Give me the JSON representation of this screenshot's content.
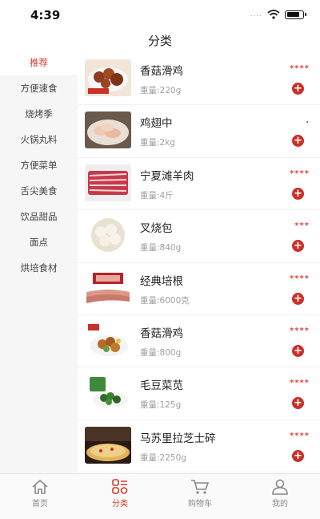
{
  "status": {
    "time": "4:39",
    "signal": "....",
    "battery_level": 0.8
  },
  "header": {
    "title": "分类"
  },
  "sidebar": {
    "items": [
      {
        "label": "推荐"
      },
      {
        "label": "方便速食"
      },
      {
        "label": "烧烤季"
      },
      {
        "label": "火锅丸料"
      },
      {
        "label": "方便菜单"
      },
      {
        "label": "舌尖美食"
      },
      {
        "label": "饮品甜品"
      },
      {
        "label": "面点"
      },
      {
        "label": "烘培食材"
      }
    ]
  },
  "products": [
    {
      "name": "香菇滑鸡",
      "weight": "重量:220g",
      "price": "****",
      "add": "+"
    },
    {
      "name": "鸡翅中",
      "weight": "重量:2kg",
      "price": ".",
      "add": "+"
    },
    {
      "name": "宁夏滩羊肉",
      "weight": "重量:4斤",
      "price": "****",
      "add": "+"
    },
    {
      "name": "叉烧包",
      "weight": "重量:840g",
      "price": "***",
      "add": "+"
    },
    {
      "name": "经典培根",
      "weight": "重量:6000克",
      "price": "****",
      "add": "+"
    },
    {
      "name": "香菇滑鸡",
      "weight": "重量:800g",
      "price": "****",
      "add": "+"
    },
    {
      "name": "毛豆菜苋",
      "weight": "重量:125g",
      "price": "****",
      "add": "+"
    },
    {
      "name": "马苏里拉芝士碎",
      "weight": "重量:2250g",
      "price": "****",
      "add": "+"
    }
  ],
  "tabbar": {
    "items": [
      {
        "label": "首页"
      },
      {
        "label": "分类"
      },
      {
        "label": "购物车"
      },
      {
        "label": "我的"
      }
    ]
  },
  "colors": {
    "accent": "#d23a2a",
    "price": "#e0463a",
    "add_button": "#c8302a"
  }
}
